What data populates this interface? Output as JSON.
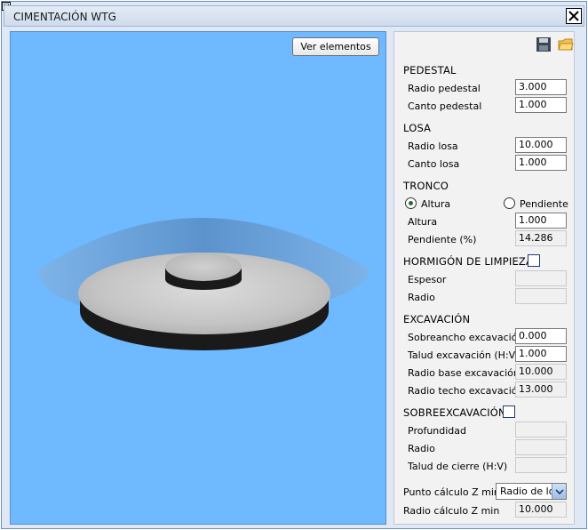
{
  "window": {
    "title": "CIMENTACIÓN WTG"
  },
  "icons": {
    "pin": "pin-icon",
    "close": "close-icon",
    "save": "save-disk-icon",
    "open": "open-folder-icon",
    "dropdown": "chevron-down-icon"
  },
  "colors": {
    "viewport_bg": "#6eb9ff",
    "panel_bg": "#f2f2f2",
    "titlebar": "#cfdbec"
  },
  "viewport": {
    "button_label": "Ver elementos"
  },
  "pedestal": {
    "title": "PEDESTAL",
    "radio_label": "Radio pedestal",
    "radio_value": "3.000",
    "canto_label": "Canto pedestal",
    "canto_value": "1.000"
  },
  "losa": {
    "title": "LOSA",
    "radio_label": "Radio losa",
    "radio_value": "10.000",
    "canto_label": "Canto losa",
    "canto_value": "1.000"
  },
  "tronco": {
    "title": "TRONCO",
    "option_altura": "Altura",
    "option_pendiente": "Pendiente",
    "selected": "Altura",
    "altura_label": "Altura",
    "altura_value": "1.000",
    "pendiente_label": "Pendiente (%)",
    "pendiente_value": "14.286"
  },
  "hormigon": {
    "title": "HORMIGÓN DE LIMPIEZA",
    "checked": false,
    "espesor_label": "Espesor",
    "espesor_value": "",
    "radio_label": "Radio",
    "radio_value": ""
  },
  "excavacion": {
    "title": "EXCAVACIÓN",
    "sobreancho_label": "Sobreancho excavación",
    "sobreancho_value": "0.000",
    "talud_label": "Talud excavación (H:V)",
    "talud_value": "1.000",
    "radio_base_label": "Radio base excavación",
    "radio_base_value": "10.000",
    "radio_techo_label": "Radio techo excavación",
    "radio_techo_value": "13.000"
  },
  "sobreexcavacion": {
    "title": "SOBREEXCAVACIÓN",
    "checked": false,
    "profundidad_label": "Profundidad",
    "profundidad_value": "",
    "radio_label": "Radio",
    "radio_value": "",
    "talud_label": "Talud de cierre (H:V)",
    "talud_value": ""
  },
  "zmin": {
    "punto_label": "Punto cálculo Z min",
    "punto_value": "Radio de los",
    "radio_label": "Radio cálculo Z min",
    "radio_value": "10.000"
  }
}
